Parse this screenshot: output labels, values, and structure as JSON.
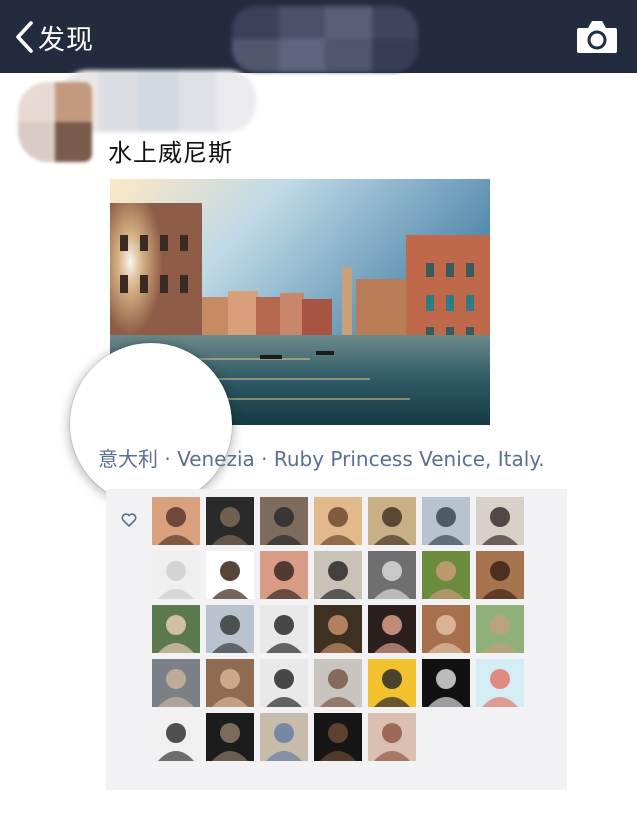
{
  "nav": {
    "back_label": "发现",
    "back_icon": "chevron-left-icon",
    "camera_icon": "camera-icon",
    "background_color": "#232c3e"
  },
  "post": {
    "text": "水上威尼斯",
    "location": "意大利 · Venezia · Ruby Princess Venice, Italy.",
    "link_color": "#5a6f92"
  },
  "likes": {
    "icon": "heart-outline-icon",
    "count": 33
  }
}
